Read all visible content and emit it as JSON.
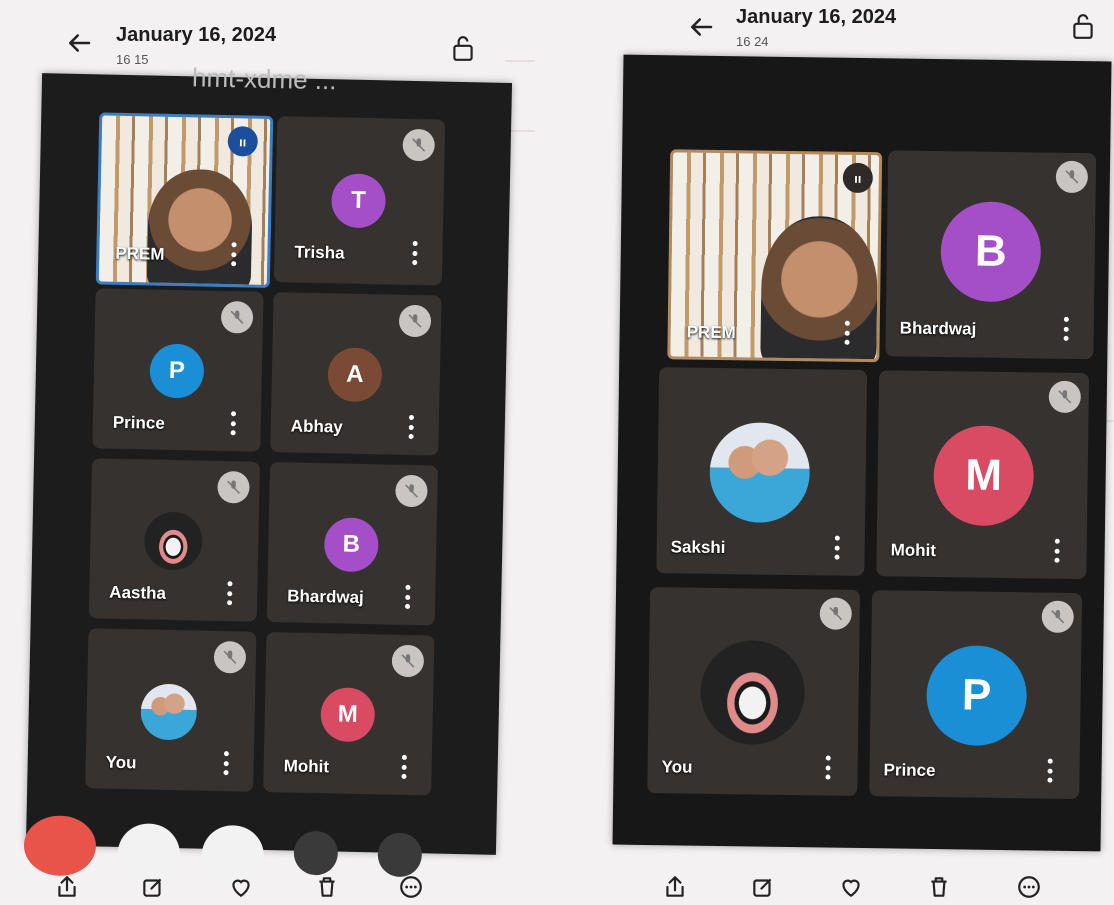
{
  "left": {
    "date": "January 16, 2024",
    "time": "16 15",
    "meeting_title": "hmt-xdme ...",
    "tiles": [
      {
        "name": "PREM",
        "type": "video"
      },
      {
        "name": "Trisha",
        "initial": "T",
        "color": "#a44fc8"
      },
      {
        "name": "Prince",
        "initial": "P",
        "color": "#1b8fd6"
      },
      {
        "name": "Abhay",
        "initial": "A",
        "color": "#7a4a35"
      },
      {
        "name": "Aastha",
        "type": "emoji"
      },
      {
        "name": "Bhardwaj",
        "initial": "B",
        "color": "#a44fc8"
      },
      {
        "name": "You",
        "type": "photo"
      },
      {
        "name": "Mohit",
        "initial": "M",
        "color": "#d84b63"
      }
    ]
  },
  "right": {
    "date": "January 16, 2024",
    "time": "16 24",
    "tiles": [
      {
        "name": "PREM",
        "type": "video"
      },
      {
        "name": "Bhardwaj",
        "initial": "B",
        "color": "#a44fc8"
      },
      {
        "name": "Sakshi",
        "type": "photo"
      },
      {
        "name": "Mohit",
        "initial": "M",
        "color": "#d84b63"
      },
      {
        "name": "You",
        "type": "emoji"
      },
      {
        "name": "Prince",
        "initial": "P",
        "color": "#1b8fd6"
      }
    ]
  },
  "icons": {
    "back": "back-arrow-icon",
    "lock": "unlock-icon",
    "bottom_bar": [
      "share-icon",
      "edit-icon",
      "heart-icon",
      "delete-icon",
      "more-options-icon"
    ]
  },
  "colors": {
    "paper": "#f4f1f2",
    "tile": "#35322f",
    "speaking_border": "#3a7fc4",
    "mute_badge": "#c9c6c2",
    "end_call": "#e8534a"
  }
}
